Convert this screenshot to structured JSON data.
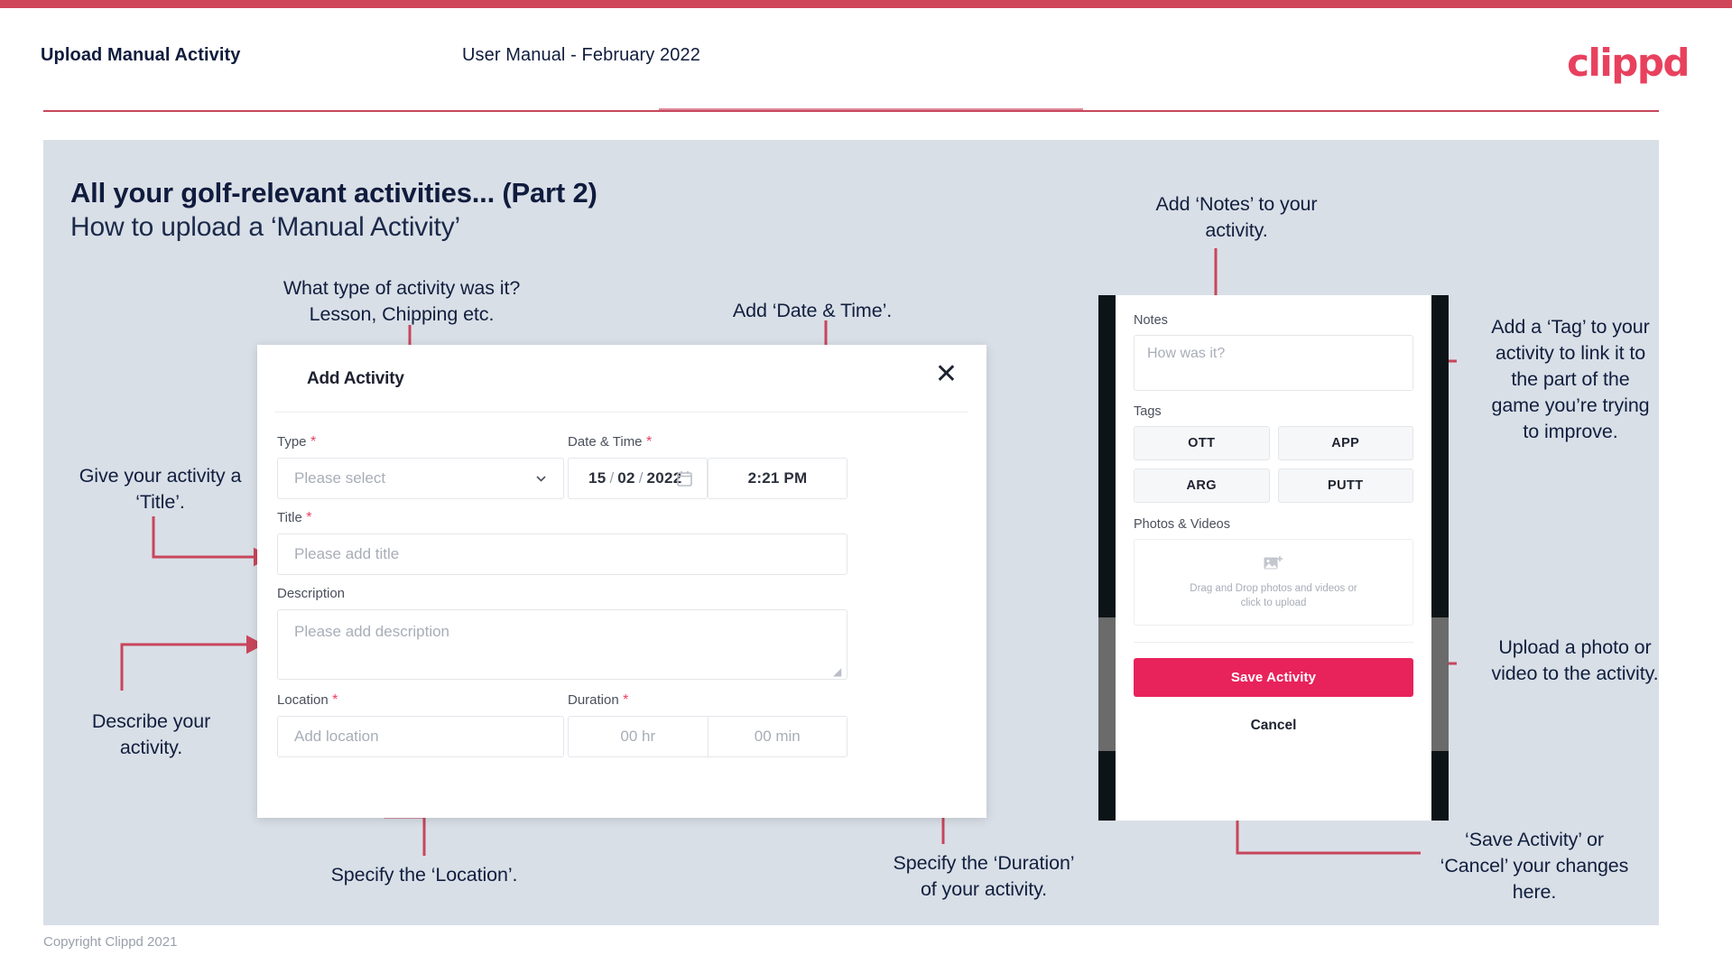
{
  "header": {
    "title": "Upload Manual Activity",
    "subtitle": "User Manual - February 2022",
    "logo": "clippd"
  },
  "slide": {
    "title": "All your golf-relevant activities... (Part 2)",
    "subtitle": "How to upload a ‘Manual Activity’"
  },
  "annotations": {
    "type": "What type of activity was it?\nLesson, Chipping etc.",
    "datetime": "Add ‘Date & Time’.",
    "title": "Give your activity a\n‘Title’.",
    "description": "Describe your\nactivity.",
    "location": "Specify the ‘Location’.",
    "duration": "Specify the ‘Duration’\nof your activity.",
    "notes": "Add ‘Notes’ to your\nactivity.",
    "tags": "Add a ‘Tag’ to your\nactivity to link it to\nthe part of the\ngame you’re trying\nto improve.",
    "upload": "Upload a photo or\nvideo to the activity.",
    "save": "‘Save Activity’ or\n‘Cancel’ your changes\nhere."
  },
  "dialog": {
    "title": "Add Activity",
    "close_icon": "close-icon",
    "fields": {
      "type": {
        "label": "Type",
        "required": true,
        "placeholder": "Please select"
      },
      "datetime": {
        "label": "Date & Time",
        "required": true,
        "day": "15",
        "month": "02",
        "year": "2022",
        "separator": "/",
        "time": "2:21 PM",
        "calendar_icon": "calendar-icon"
      },
      "title": {
        "label": "Title",
        "required": true,
        "placeholder": "Please add title"
      },
      "description": {
        "label": "Description",
        "required": false,
        "placeholder": "Please add description"
      },
      "location": {
        "label": "Location",
        "required": true,
        "placeholder": "Add location"
      },
      "duration": {
        "label": "Duration",
        "required": true,
        "hours": "00 hr",
        "minutes": "00 min"
      }
    }
  },
  "phone": {
    "notes_label": "Notes",
    "notes_placeholder": "How was it?",
    "tags_label": "Tags",
    "tags": [
      "OTT",
      "APP",
      "ARG",
      "PUTT"
    ],
    "photos_label": "Photos & Videos",
    "dropzone_line1": "Drag and Drop photos and videos or",
    "dropzone_line2": "click to upload",
    "dropzone_icon": "image-add-icon",
    "save_label": "Save Activity",
    "cancel_label": "Cancel"
  },
  "footer": {
    "copyright": "Copyright Clippd 2021"
  },
  "colors": {
    "brand_red": "#e8415e",
    "save_pink": "#e8225a",
    "arrow": "#c8465c",
    "slide_bg": "#d9dfe7",
    "ink": "#101c3d"
  }
}
